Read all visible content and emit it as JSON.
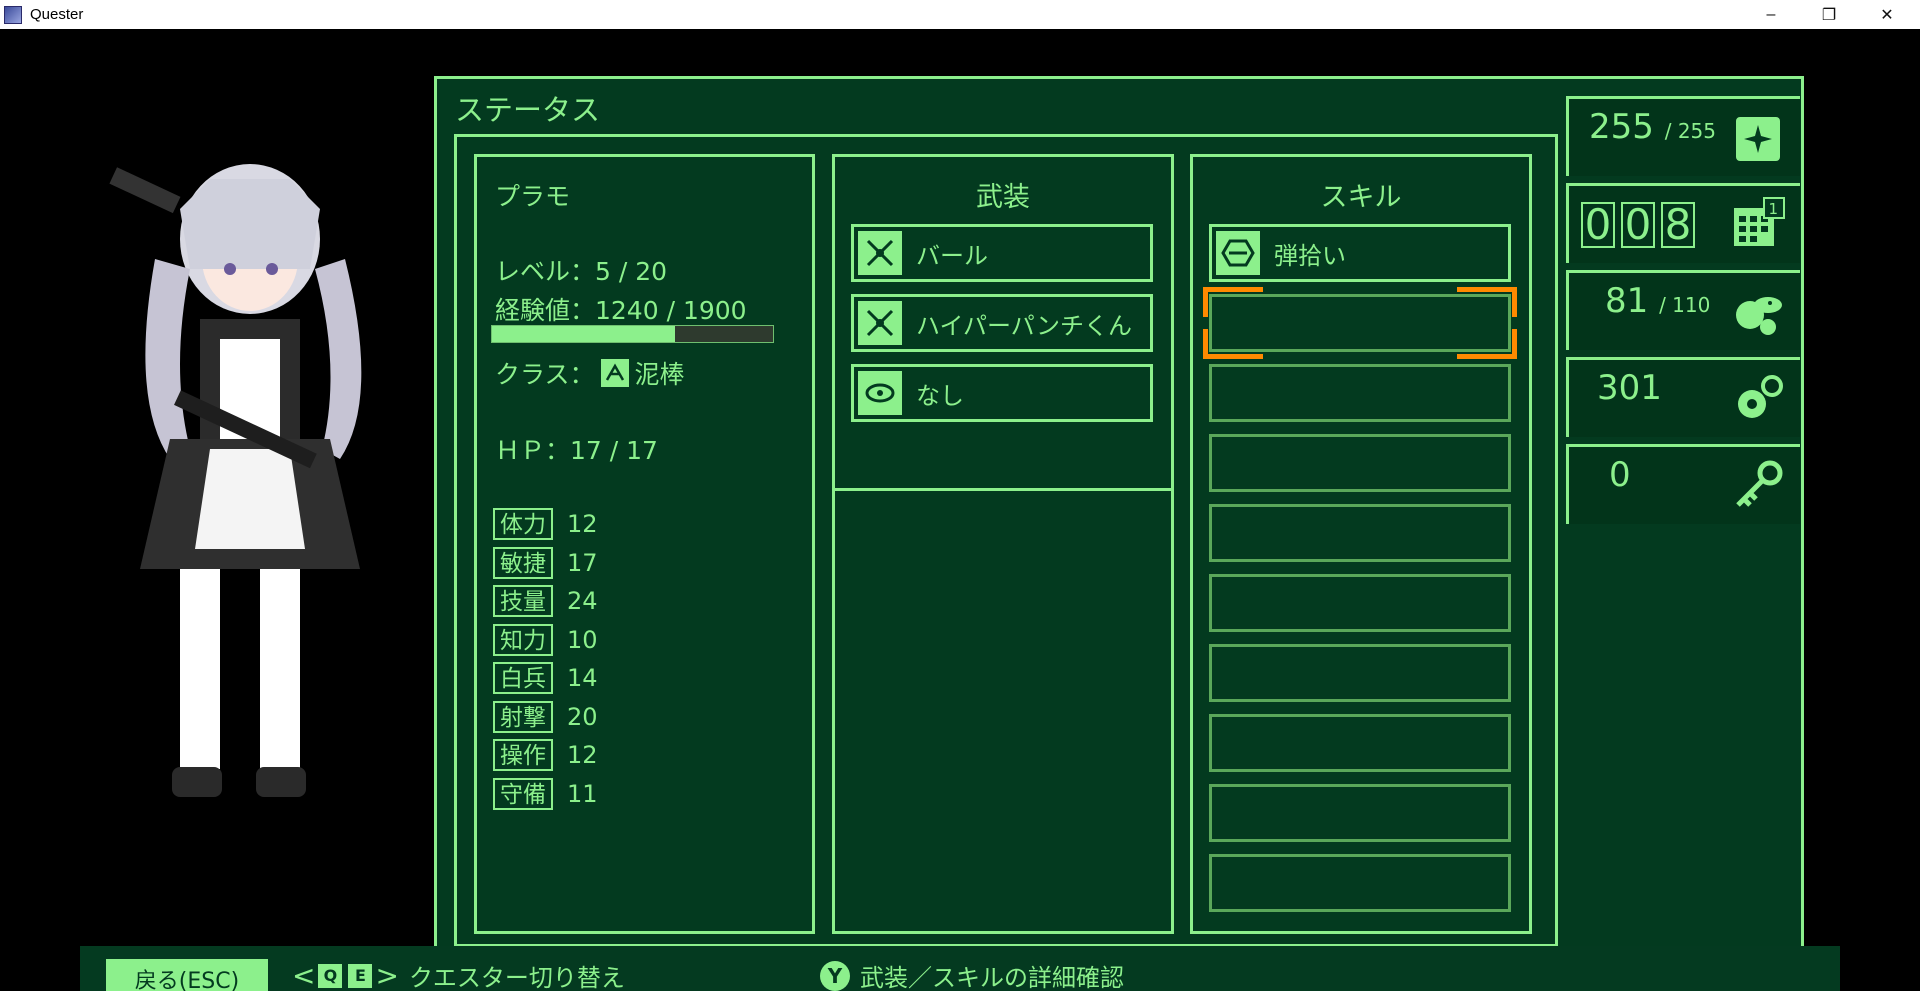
{
  "window": {
    "title": "Quester",
    "minimize": "–",
    "maximize": "❐",
    "close": "✕"
  },
  "panel": {
    "title": "ステータス"
  },
  "character": {
    "name": "プラモ",
    "level_text": "レベル：5 / 20",
    "exp_text": "経験値：1240 / 1900",
    "exp_progress": 0.653,
    "class_prefix": "クラス：",
    "class_name": "泥棒",
    "hp_text": "ＨＰ：17 / 17",
    "attributes": [
      {
        "label": "体力",
        "value": "12"
      },
      {
        "label": "敏捷",
        "value": "17"
      },
      {
        "label": "技量",
        "value": "24"
      },
      {
        "label": "知力",
        "value": "10"
      },
      {
        "label": "白兵",
        "value": "14"
      },
      {
        "label": "射撃",
        "value": "20"
      },
      {
        "label": "操作",
        "value": "12"
      },
      {
        "label": "守備",
        "value": "11"
      }
    ]
  },
  "equipment": {
    "header": "武装",
    "slots": [
      {
        "label": "バール",
        "icon": "melee-weapon-icon"
      },
      {
        "label": "ハイパーパンチくん",
        "icon": "melee-weapon-icon"
      },
      {
        "label": "なし",
        "icon": "accessory-icon"
      }
    ]
  },
  "skills": {
    "header": "スキル",
    "slots": [
      {
        "label": "弾拾い",
        "icon": "skill-hex-icon"
      },
      {
        "label": ""
      },
      {
        "label": ""
      },
      {
        "label": ""
      },
      {
        "label": ""
      },
      {
        "label": ""
      },
      {
        "label": ""
      },
      {
        "label": ""
      },
      {
        "label": ""
      }
    ],
    "selected_index": 1
  },
  "resources": {
    "supply": {
      "value": "255",
      "max": "/ 255",
      "icon": "sparkle-jar-icon"
    },
    "day": {
      "digits": [
        "0",
        "0",
        "8"
      ],
      "badge": "1",
      "icon": "calendar-icon"
    },
    "food": {
      "value": "81",
      "max": "/ 110",
      "icon": "food-icon"
    },
    "parts": {
      "value": "301",
      "icon": "gears-icon"
    },
    "keys": {
      "value": "0",
      "icon": "key-icon"
    }
  },
  "footer": {
    "back_label": "戻る(ESC)",
    "key_q": "Q",
    "key_e": "E",
    "switch_label": "クエスター切り替え",
    "y_key": "Y",
    "detail_label": "武装／スキルの詳細確認"
  },
  "colors": {
    "accent": "#8cf08c",
    "panel_bg": "#033a1f",
    "highlight": "#ff8a00"
  }
}
